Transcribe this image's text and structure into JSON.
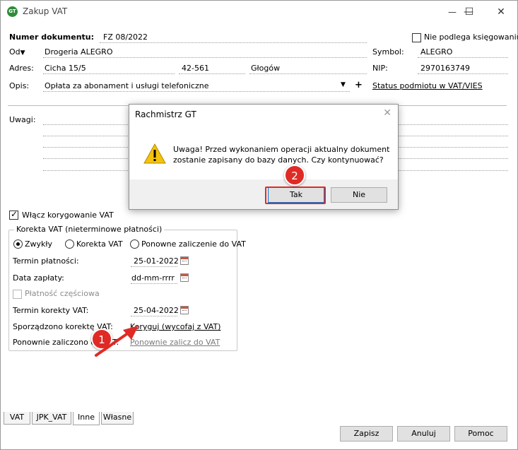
{
  "window": {
    "title": "Zakup VAT",
    "minimize_icon": "minimize-icon",
    "maximize_icon": "maximize-icon",
    "close_icon": "close-icon"
  },
  "header": {
    "doc_number_label": "Numer dokumentu:",
    "doc_number_value": "FZ 08/2022",
    "not_booked_label": "Nie podlega księgowaniu",
    "from_label": "Od",
    "from_value": "Drogeria ALEGRO",
    "symbol_label": "Symbol:",
    "symbol_value": "ALEGRO",
    "address_label": "Adres:",
    "street": "Cicha  15/5",
    "postal": "42-561",
    "city": "Głogów",
    "nip_label": "NIP:",
    "nip_value": "2970163749",
    "desc_label": "Opis:",
    "desc_value": "Opłata za abonament i usługi telefoniczne",
    "plus": "+",
    "vat_status_link": "Status podmiotu w VAT/VIES",
    "notes_label": "Uwagi:"
  },
  "correction": {
    "enable_label": "Włącz korygowanie VAT",
    "enabled": true,
    "group_title": "Korekta VAT (nieterminowe płatności)",
    "radio_normal": "Zwykły",
    "radio_correction": "Korekta VAT",
    "radio_recount": "Ponowne zaliczenie do VAT",
    "selected": "Zwykły",
    "due_date_label": "Termin płatności:",
    "due_date_value": "25-01-2022",
    "pay_date_label": "Data zapłaty:",
    "pay_date_value": "dd-mm-rrrr",
    "partial_label": "Płatność częściowa",
    "corr_date_label": "Termin korekty VAT:",
    "corr_date_value": "25-04-2022",
    "made_label": "Sporządzono korektę VAT:",
    "made_link": "Koryguj (wycofaj z VAT)",
    "recounted_label": "Ponownie zaliczono do VAT:",
    "recounted_link": "Ponownie zalicz do VAT"
  },
  "tabs": [
    "VAT",
    "JPK_VAT",
    "Inne",
    "Własne"
  ],
  "active_tab": "Inne",
  "buttons": {
    "save": "Zapisz",
    "cancel": "Anuluj",
    "help": "Pomoc"
  },
  "dialog": {
    "title": "Rachmistrz GT",
    "line1": "Uwaga! Przed wykonaniem operacji aktualny dokument",
    "line2": "zostanie zapisany do bazy danych. Czy kontynuować?",
    "yes": "Tak",
    "no": "Nie",
    "icon": "warning-icon"
  },
  "annotations": {
    "step1": "1",
    "step2": "2"
  },
  "colors": {
    "annotation_red": "#e02a25",
    "default_button_border": "#0078d7"
  }
}
